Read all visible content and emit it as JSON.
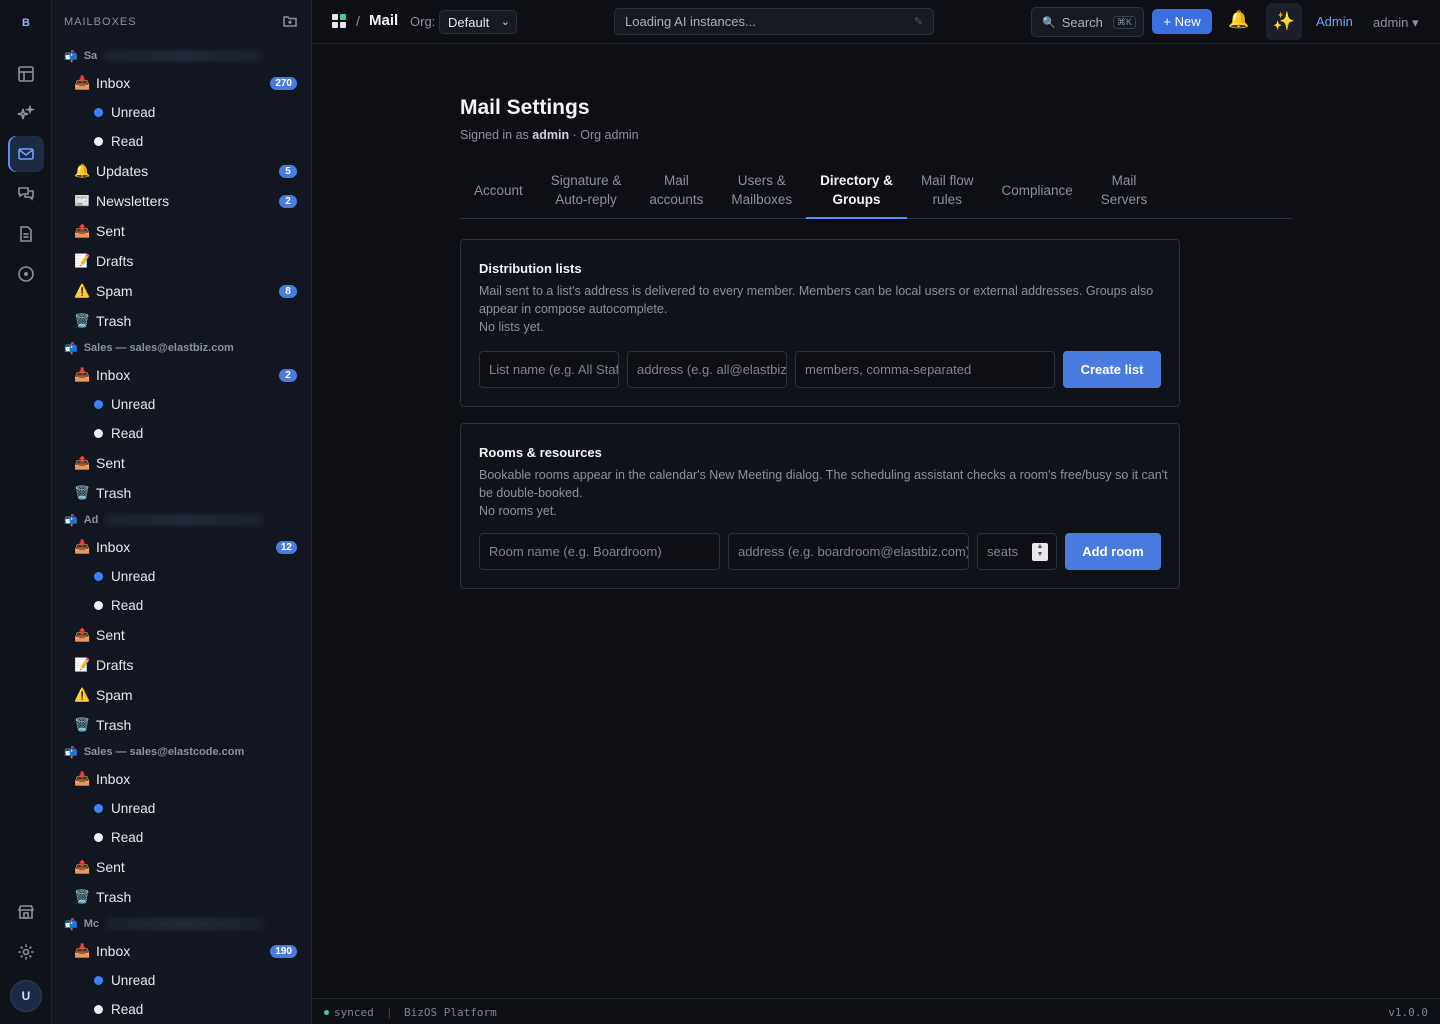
{
  "rail": {
    "logo": "B",
    "avatar": "U"
  },
  "sidebar": {
    "header": "MAILBOXES",
    "groups": [
      {
        "account": "Sa",
        "items": [
          {
            "icon": "📥",
            "label": "Inbox",
            "badge": "270"
          },
          {
            "sub": "Unread",
            "dot": "blue"
          },
          {
            "sub": "Read",
            "dot": "white"
          },
          {
            "icon": "🔔",
            "label": "Updates",
            "badge": "5"
          },
          {
            "icon": "📰",
            "label": "Newsletters",
            "badge": "2"
          },
          {
            "icon": "📤",
            "label": "Sent"
          },
          {
            "icon": "📝",
            "label": "Drafts"
          },
          {
            "icon": "⚠️",
            "label": "Spam",
            "badge": "8"
          },
          {
            "icon": "🗑️",
            "label": "Trash"
          }
        ]
      },
      {
        "account": "Sales — sales@elastbiz.com",
        "items": [
          {
            "icon": "📥",
            "label": "Inbox",
            "badge": "2"
          },
          {
            "sub": "Unread",
            "dot": "blue"
          },
          {
            "sub": "Read",
            "dot": "white"
          },
          {
            "icon": "📤",
            "label": "Sent"
          },
          {
            "icon": "🗑️",
            "label": "Trash"
          }
        ]
      },
      {
        "account": "Ad",
        "items": [
          {
            "icon": "📥",
            "label": "Inbox",
            "badge": "12"
          },
          {
            "sub": "Unread",
            "dot": "blue"
          },
          {
            "sub": "Read",
            "dot": "white"
          },
          {
            "icon": "📤",
            "label": "Sent"
          },
          {
            "icon": "📝",
            "label": "Drafts"
          },
          {
            "icon": "⚠️",
            "label": "Spam"
          },
          {
            "icon": "🗑️",
            "label": "Trash"
          }
        ]
      },
      {
        "account": "Sales — sales@elastcode.com",
        "items": [
          {
            "icon": "📥",
            "label": "Inbox"
          },
          {
            "sub": "Unread",
            "dot": "blue"
          },
          {
            "sub": "Read",
            "dot": "white"
          },
          {
            "icon": "📤",
            "label": "Sent"
          },
          {
            "icon": "🗑️",
            "label": "Trash"
          }
        ]
      },
      {
        "account": "Mc",
        "items": [
          {
            "icon": "📥",
            "label": "Inbox",
            "badge": "190"
          },
          {
            "sub": "Unread",
            "dot": "blue"
          },
          {
            "sub": "Read",
            "dot": "white"
          }
        ]
      }
    ]
  },
  "topbar": {
    "app": "Mail",
    "org_label": "Org:",
    "org_value": "Default",
    "ai_status": "Loading AI instances...",
    "search_label": "Search",
    "search_kbd": "⌘K",
    "new_label": "+ New",
    "admin_link": "Admin",
    "user_menu": "admin ▾"
  },
  "page": {
    "title": "Mail Settings",
    "signed_prefix": "Signed in as",
    "signed_user": "admin",
    "signed_suffix": "· Org admin",
    "tabs": [
      {
        "line1": "Account",
        "line2": "",
        "active": false
      },
      {
        "line1": "Signature &",
        "line2": "Auto-reply",
        "active": false
      },
      {
        "line1": "Mail",
        "line2": "accounts",
        "active": false
      },
      {
        "line1": "Users &",
        "line2": "Mailboxes",
        "active": false
      },
      {
        "line1": "Directory &",
        "line2": "Groups",
        "active": true
      },
      {
        "line1": "Mail flow",
        "line2": "rules",
        "active": false
      },
      {
        "line1": "Compliance",
        "line2": "",
        "active": false
      },
      {
        "line1": "Mail",
        "line2": "Servers",
        "active": false
      }
    ]
  },
  "distribution": {
    "title": "Distribution lists",
    "description": "Mail sent to a list's address is delivered to every member. Members can be local users or external addresses. Groups also appear in compose autocomplete.",
    "empty": "No lists yet.",
    "name_placeholder": "List name (e.g. All Staff)",
    "address_placeholder": "address (e.g. all@elastbiz.com)",
    "members_placeholder": "members, comma-separated",
    "button": "Create list"
  },
  "rooms": {
    "title": "Rooms & resources",
    "description": "Bookable rooms appear in the calendar's New Meeting dialog. The scheduling assistant checks a room's free/busy so it can't be double-booked.",
    "empty": "No rooms yet.",
    "name_placeholder": "Room name (e.g. Boardroom)",
    "address_placeholder": "address (e.g. boardroom@elastbiz.com)",
    "seats_placeholder": "seats",
    "button": "Add room"
  },
  "status": {
    "synced": "synced",
    "separator": "|",
    "platform": "BizOS Platform",
    "version": "v1.0.0"
  }
}
